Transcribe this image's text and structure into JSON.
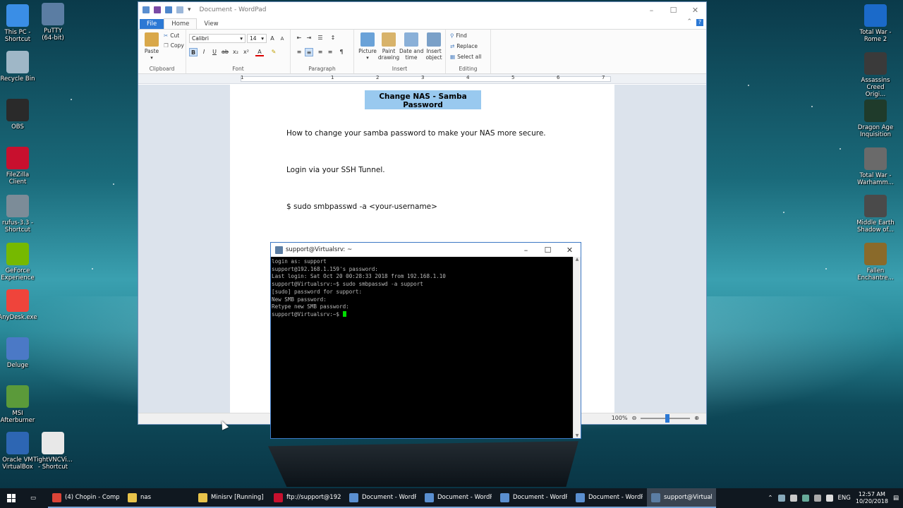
{
  "desktop": {
    "left_icons": [
      {
        "label": "This PC -\nShortcut",
        "icon": "this-pc-icon",
        "color": "#3a8ee6"
      },
      {
        "label": "PuTTY\n(64-bit)",
        "icon": "putty-icon",
        "color": "#5b7da3"
      },
      {
        "label": "Recycle Bin",
        "icon": "recycle-bin-icon",
        "color": "#9fb7c7"
      },
      {
        "label": "OBS",
        "icon": "obs-icon",
        "color": "#2a2a2a"
      },
      {
        "label": "FileZilla\nClient",
        "icon": "filezilla-icon",
        "color": "#c8102e"
      },
      {
        "label": "rufus-3.3 -\nShortcut",
        "icon": "rufus-icon",
        "color": "#7c8c98"
      },
      {
        "label": "GeForce\nExperience",
        "icon": "geforce-icon",
        "color": "#76b900"
      },
      {
        "label": "AnyDesk.exe",
        "icon": "anydesk-icon",
        "color": "#ef443b"
      },
      {
        "label": "Deluge",
        "icon": "deluge-icon",
        "color": "#4b79c6"
      },
      {
        "label": "MSI\nAfterburner",
        "icon": "msi-afterburner-icon",
        "color": "#5b9a3a"
      },
      {
        "label": "Oracle VM\nVirtualBox",
        "icon": "virtualbox-icon",
        "color": "#2d66b3"
      },
      {
        "label": "TightVNCVi...\n- Shortcut",
        "icon": "tightvnc-icon",
        "color": "#e8e8e8"
      }
    ],
    "right_icons": [
      {
        "label": "Total War -\nRome 2",
        "icon": "total-war-rome-icon",
        "color": "#1b6ac9"
      },
      {
        "label": "Assassins\nCreed Origi...",
        "icon": "assassins-creed-icon",
        "color": "#3a3a3a"
      },
      {
        "label": "Dragon Age\nInquisition",
        "icon": "dragon-age-icon",
        "color": "#1f3b2b"
      },
      {
        "label": "Total War -\nWarhamm...",
        "icon": "total-war-warhammer-icon",
        "color": "#6a6a6a"
      },
      {
        "label": "Middle Earth\nShadow of...",
        "icon": "middle-earth-icon",
        "color": "#4a4a4a"
      },
      {
        "label": "Fallen\nEnchantre...",
        "icon": "fallen-enchantress-icon",
        "color": "#8a6a2a"
      }
    ]
  },
  "wordpad": {
    "title": "Document - WordPad",
    "tabs": {
      "file": "File",
      "home": "Home",
      "view": "View"
    },
    "clipboard": {
      "paste": "Paste",
      "cut": "Cut",
      "copy": "Copy",
      "label": "Clipboard"
    },
    "font": {
      "family": "Calibri",
      "size": "14",
      "label": "Font"
    },
    "paragraph": {
      "label": "Paragraph"
    },
    "insert": {
      "picture": "Picture",
      "paint": "Paint\ndrawing",
      "datetime": "Date and\ntime",
      "object": "Insert\nobject",
      "label": "Insert"
    },
    "editing": {
      "find": "Find",
      "replace": "Replace",
      "select_all": "Select all",
      "label": "Editing"
    },
    "ruler_numbers": [
      "1",
      "1",
      "2",
      "3",
      "4",
      "5",
      "6",
      "7"
    ],
    "document": {
      "title": "Change NAS - Samba Password",
      "line1": "How to change your samba password to make your NAS more secure.",
      "line2": "Login via your SSH Tunnel.",
      "line3": "$ sudo smbpasswd -a <your-username>"
    },
    "zoom": "100%"
  },
  "putty": {
    "title": "support@Virtualsrv: ~",
    "lines": [
      "login as: support",
      "support@192.168.1.159's password:",
      "Last login: Sat Oct 20 00:28:33 2018 from 192.168.1.10",
      "support@Virtualsrv:~$ sudo smbpasswd -a support",
      "[sudo] password for support:",
      "New SMB password:",
      "Retype new SMB password:"
    ],
    "prompt": "support@Virtualsrv:~$ "
  },
  "taskbar": {
    "items": [
      {
        "label": "(4) Chopin - Compl...",
        "icon": "chrome-icon",
        "color": "#db4437"
      },
      {
        "label": "nas",
        "icon": "folder-icon",
        "color": "#e8c34a"
      },
      {
        "label": "Minisrv [Running] - ...",
        "icon": "virtualbox-icon",
        "color": "#e8c34a"
      },
      {
        "label": "ftp://support@192....",
        "icon": "filezilla-icon",
        "color": "#c8102e"
      },
      {
        "label": "Document - WordP",
        "icon": "wordpad-icon",
        "color": "#5a8fd0"
      },
      {
        "label": "Document - WordP",
        "icon": "wordpad-icon",
        "color": "#5a8fd0"
      },
      {
        "label": "Document - WordP",
        "icon": "wordpad-icon",
        "color": "#5a8fd0"
      },
      {
        "label": "Document - WordP",
        "icon": "wordpad-icon",
        "color": "#5a8fd0"
      },
      {
        "label": "support@Virtualsrv",
        "icon": "putty-icon",
        "color": "#5b7da3"
      }
    ],
    "language": "ENG",
    "time": "12:57 AM",
    "date": "10/20/2018"
  }
}
